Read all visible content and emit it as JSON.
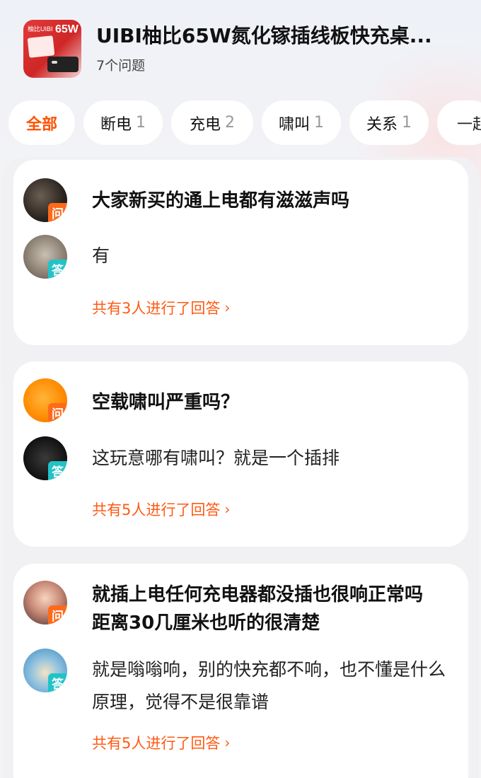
{
  "header": {
    "product_title": "UIBI柚比65W氮化镓插线板快充桌...",
    "question_count": "7个问题",
    "thumb_brand": "柚比UIBI",
    "thumb_big": "65W"
  },
  "tabs": [
    {
      "label": "全部",
      "count": ""
    },
    {
      "label": "断电",
      "count": "1"
    },
    {
      "label": "充电",
      "count": "2"
    },
    {
      "label": "啸叫",
      "count": "1"
    },
    {
      "label": "关系",
      "count": "1"
    },
    {
      "label": "一起",
      "count": ""
    }
  ],
  "badges": {
    "ask": "问",
    "answer": "答"
  },
  "cards": [
    {
      "question": "大家新买的通上电都有滋滋声吗",
      "answer": "有",
      "more": "共有3人进行了回答"
    },
    {
      "question": "空载啸叫严重吗？",
      "answer": "这玩意哪有啸叫？就是一个插排",
      "more": "共有5人进行了回答"
    },
    {
      "question": "就插上电任何充电器都没插也很响正常吗  距离30几厘米也听的很清楚",
      "answer": "就是嗡嗡响，别的快充都不响，也不懂是什么原理，觉得不是很靠谱",
      "more": "共有5人进行了回答"
    }
  ],
  "colors": {
    "accent": "#ff5000",
    "ask_badge": "#ff6a1a",
    "answer_badge": "#22c3c8"
  }
}
